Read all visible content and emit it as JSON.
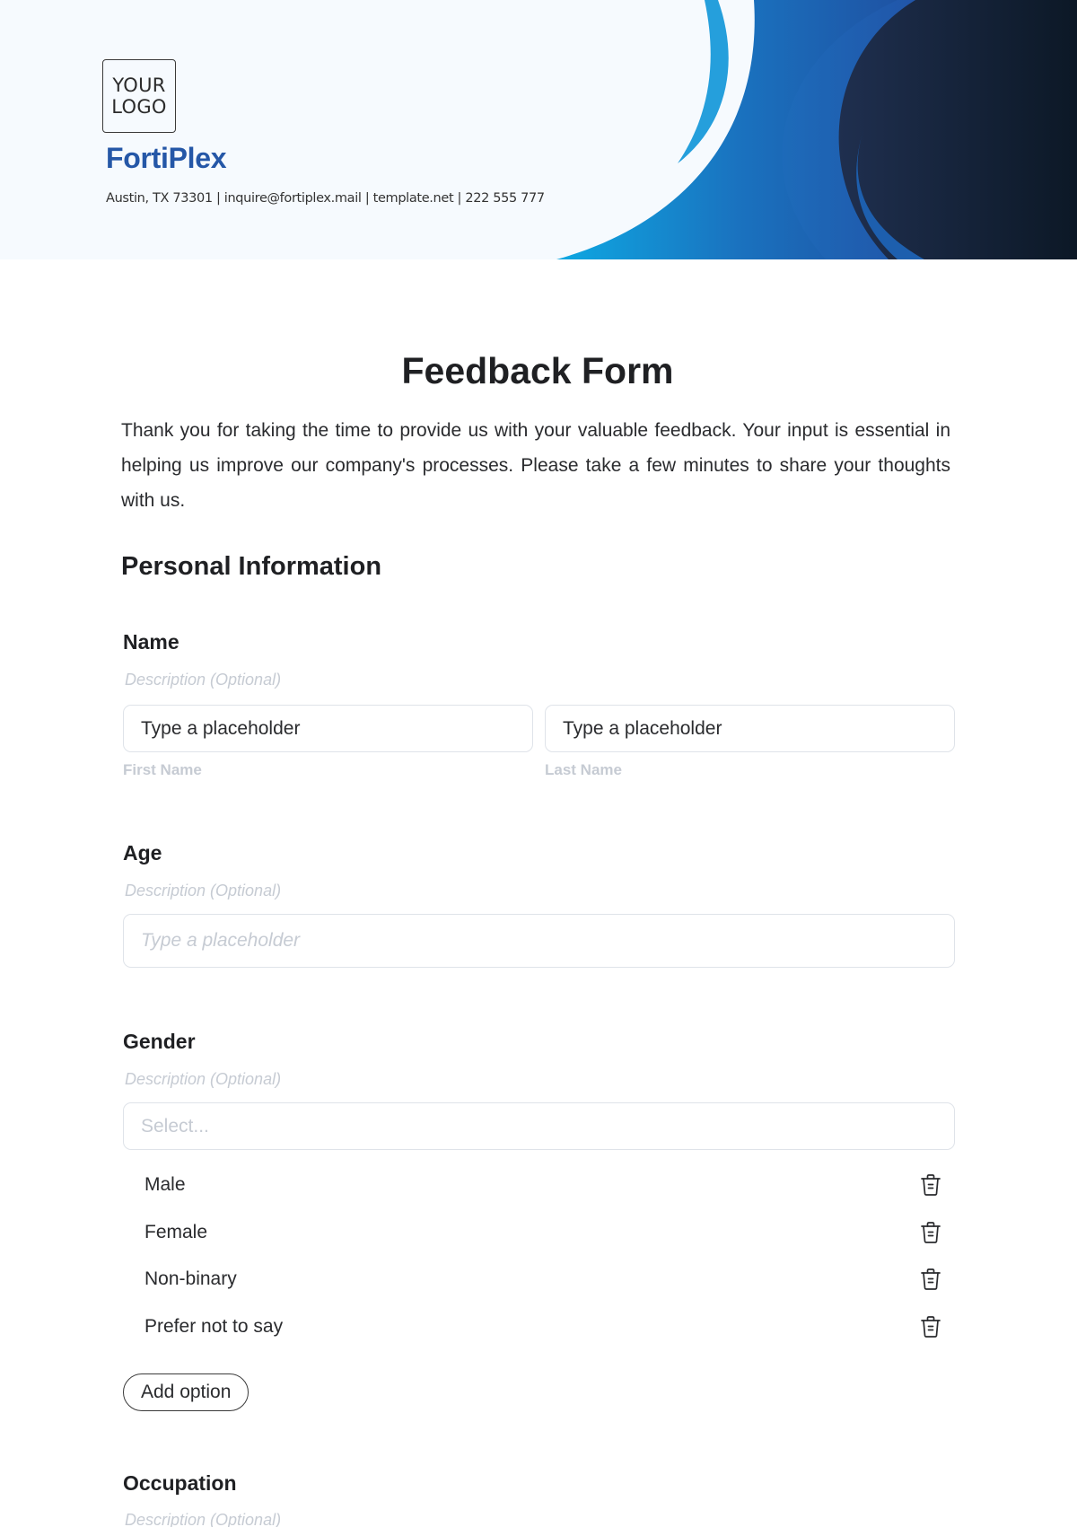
{
  "header": {
    "logo_line1": "YOUR",
    "logo_line2": "LOGO",
    "brand_name": "FortiPlex",
    "contact_line": "Austin, TX 73301 | inquire@fortiplex.mail | template.net | 222 555 777",
    "colors": {
      "background": "#f6fafe",
      "brand": "#2557a7",
      "wave_light": "#259fdc",
      "wave_mid": "#1d63b4",
      "wave_dark": "#0d1a2b"
    }
  },
  "form": {
    "title": "Feedback Form",
    "intro": "Thank you for taking the time to provide us with your valuable feedback. Your input is essential in helping us improve our company's processes. Please take a few minutes to share your thoughts with us.",
    "section_title": "Personal Information",
    "fields": {
      "name": {
        "label": "Name",
        "description": "Description (Optional)",
        "first_value": "Type a placeholder",
        "last_value": "Type a placeholder",
        "first_sublabel": "First Name",
        "last_sublabel": "Last Name"
      },
      "age": {
        "label": "Age",
        "description": "Description (Optional)",
        "placeholder": "Type a placeholder"
      },
      "gender": {
        "label": "Gender",
        "description": "Description (Optional)",
        "select_placeholder": "Select...",
        "options": [
          {
            "label": "Male",
            "icon": "trash-icon"
          },
          {
            "label": "Female",
            "icon": "trash-icon"
          },
          {
            "label": "Non-binary",
            "icon": "trash-icon"
          },
          {
            "label": "Prefer not to say",
            "icon": "trash-icon"
          }
        ],
        "add_option_label": "Add option"
      },
      "occupation": {
        "label": "Occupation",
        "description": "Description (Optional)"
      }
    }
  }
}
